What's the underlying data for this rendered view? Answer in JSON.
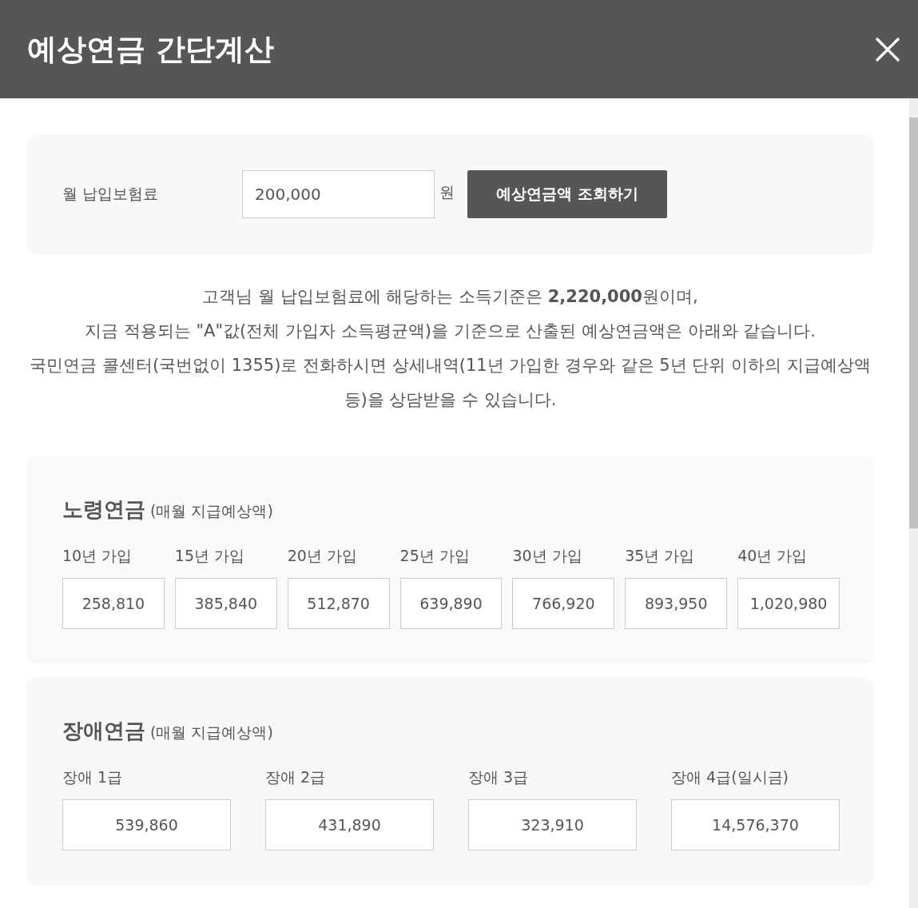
{
  "title": "예상연금 간단계산",
  "premium": {
    "label": "월 납입보험료",
    "value": "200,000",
    "unit": "원",
    "button": "예상연금액 조회하기"
  },
  "notice": [
    "고객님 월 납입보험료에 해당하는 소득기준은 **2,220,000**원이며,",
    "지금 적용되는 \"A\"값(전체 가입자 소득평균액)을 기준으로 산출된 예상연금액은 아래와 같습니다.",
    "국민연금 콜센터(국번없이 1355)로 전화하시면 상세내역(11년 가입한 경우와 같은 5년 단위 이하의 지급예상액 등)을 상담받을 수 있습니다."
  ],
  "sections": [
    {
      "title": "노령연금",
      "subtitle": "(매월 지급예상액)",
      "items": [
        {
          "label": "10년 가입",
          "value": "258,810"
        },
        {
          "label": "15년 가입",
          "value": "385,840"
        },
        {
          "label": "20년 가입",
          "value": "512,870"
        },
        {
          "label": "25년 가입",
          "value": "639,890"
        },
        {
          "label": "30년 가입",
          "value": "766,920"
        },
        {
          "label": "35년 가입",
          "value": "893,950"
        },
        {
          "label": "40년 가입",
          "value": "1,020,980"
        }
      ]
    },
    {
      "title": "장애연금",
      "subtitle": "(매월 지급예상액)",
      "items": [
        {
          "label": "장애 1급",
          "value": "539,860"
        },
        {
          "label": "장애 2급",
          "value": "431,890"
        },
        {
          "label": "장애 3급",
          "value": "323,910"
        },
        {
          "label": "장애 4급(일시금)",
          "value": "14,576,370"
        }
      ]
    }
  ]
}
